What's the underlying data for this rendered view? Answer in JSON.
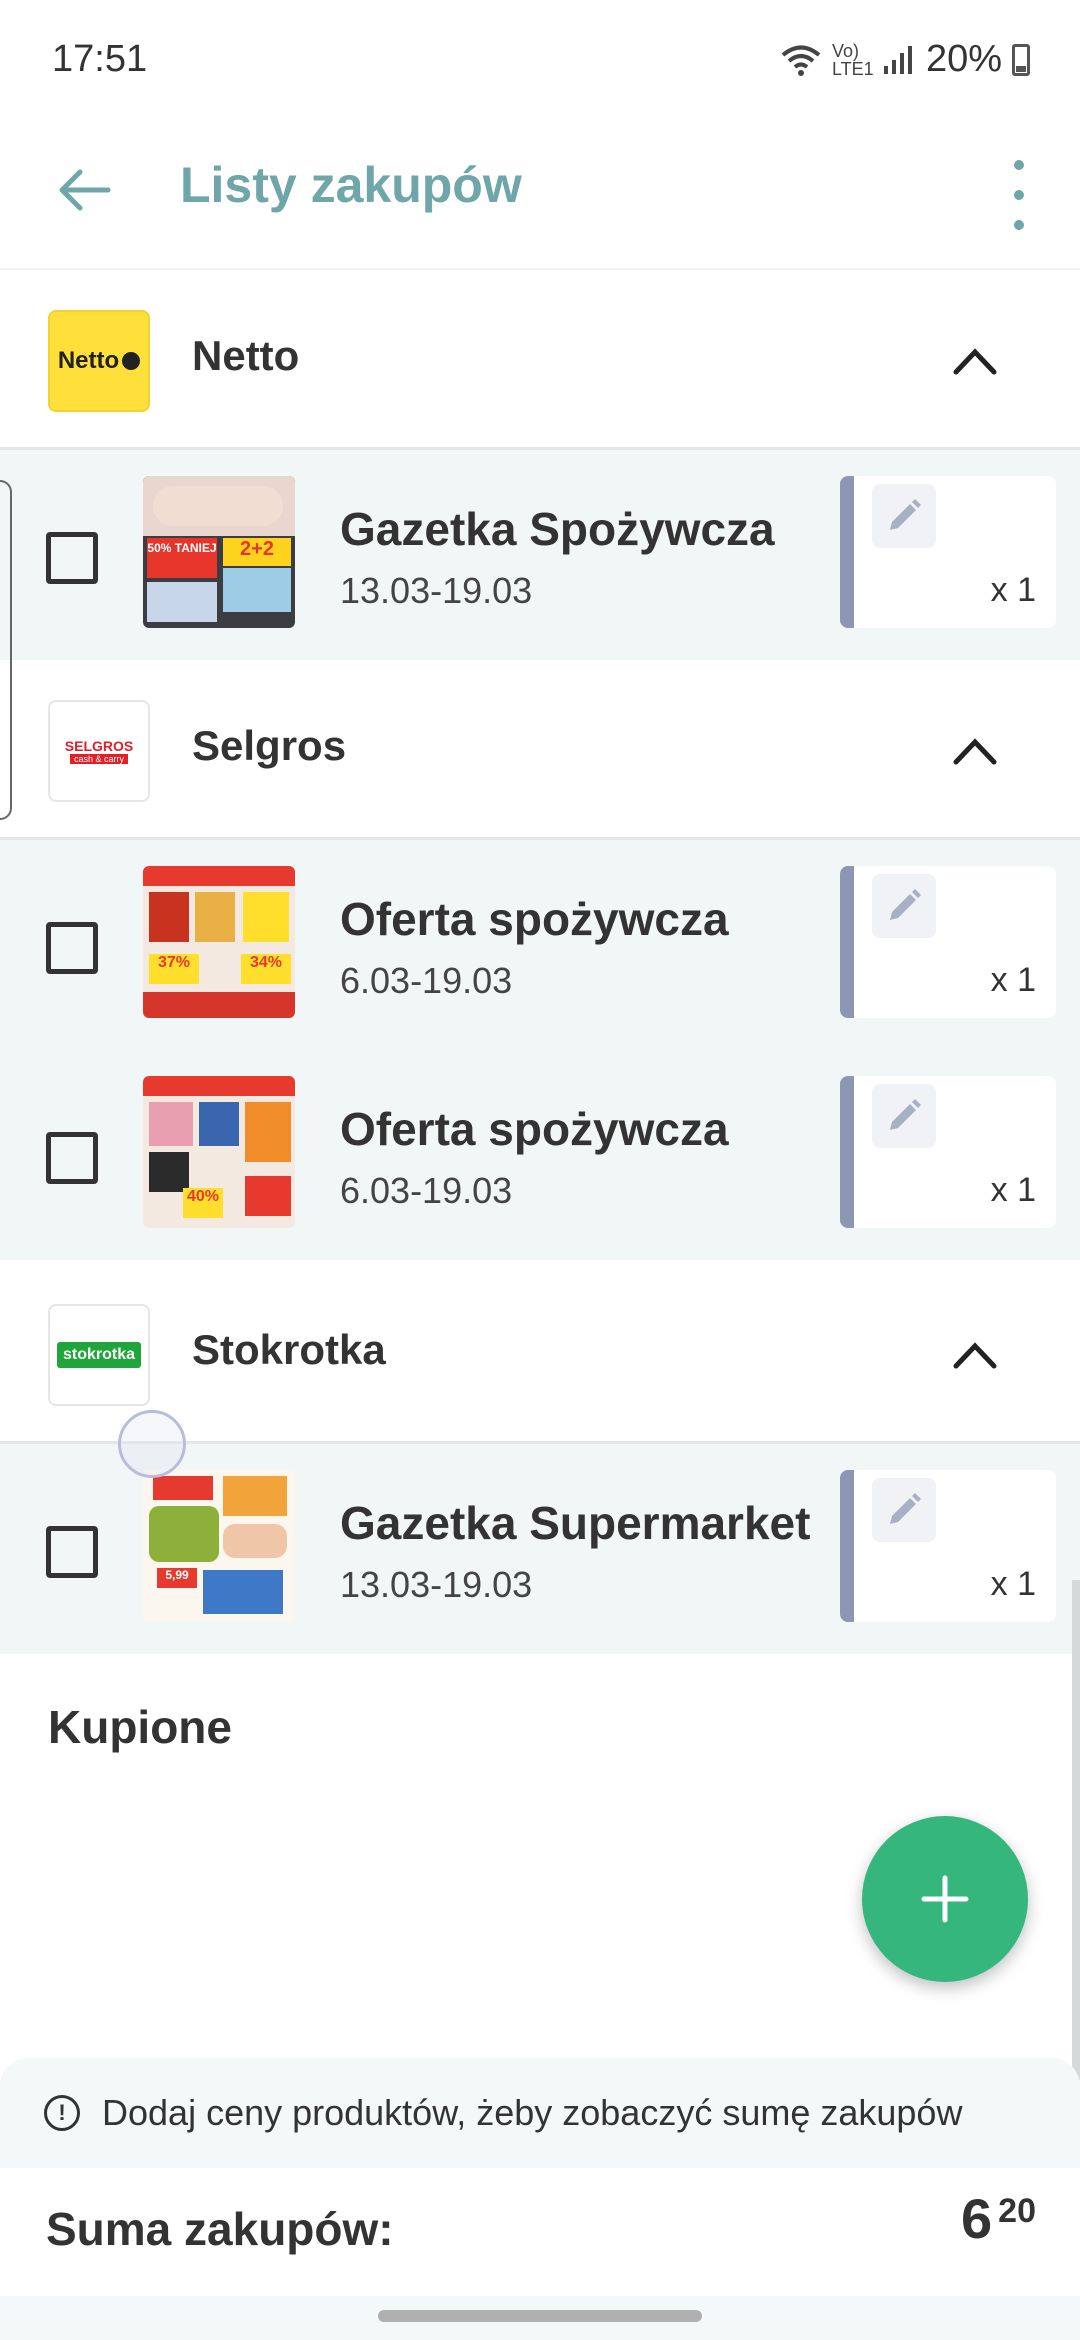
{
  "status_bar": {
    "time": "17:51",
    "network_label": "Vo) LTE1",
    "battery": "20%"
  },
  "app_bar": {
    "title": "Listy zakupów",
    "back_icon": "arrow-left-icon",
    "menu_icon": "more-vertical-icon"
  },
  "sections": [
    {
      "store": "Netto",
      "logo_text": "Netto",
      "logo_color": "#ffe03a",
      "items": [
        {
          "title": "Gazetka Spożywcza",
          "date": "13.03-19.03",
          "qty": "x 1",
          "thumb_label": "50% TANIEJ",
          "thumb_badge": "2+2"
        }
      ]
    },
    {
      "store": "Selgros",
      "logo_text": "SELGROS",
      "logo_subtext": "cash & carry",
      "logo_color": "#e31e26",
      "items": [
        {
          "title": "Oferta spożywcza",
          "date": "6.03-19.03",
          "qty": "x 1",
          "thumb_label": "37%",
          "thumb_badge": "34%"
        },
        {
          "title": "Oferta spożywcza",
          "date": "6.03-19.03",
          "qty": "x 1",
          "thumb_label": "40%",
          "thumb_badge": ""
        }
      ]
    },
    {
      "store": "Stokrotka",
      "logo_text": "stokrotka",
      "logo_color": "#1fa53a",
      "items": [
        {
          "title": "Gazetka Supermarket",
          "date": "13.03-19.03",
          "qty": "x 1",
          "thumb_label": "5,99",
          "thumb_badge": ""
        }
      ]
    }
  ],
  "bought_section_title": "Kupione",
  "fab_icon": "plus-icon",
  "info_banner": {
    "icon": "info-circle-icon",
    "text": "Dodaj ceny produktów, żeby zobaczyć sumę zakupów"
  },
  "sum": {
    "label": "Suma zakupów:",
    "value_int": "6",
    "value_dec": "20"
  },
  "accent_color": "#6fa6a9",
  "fab_color": "#35b67c"
}
